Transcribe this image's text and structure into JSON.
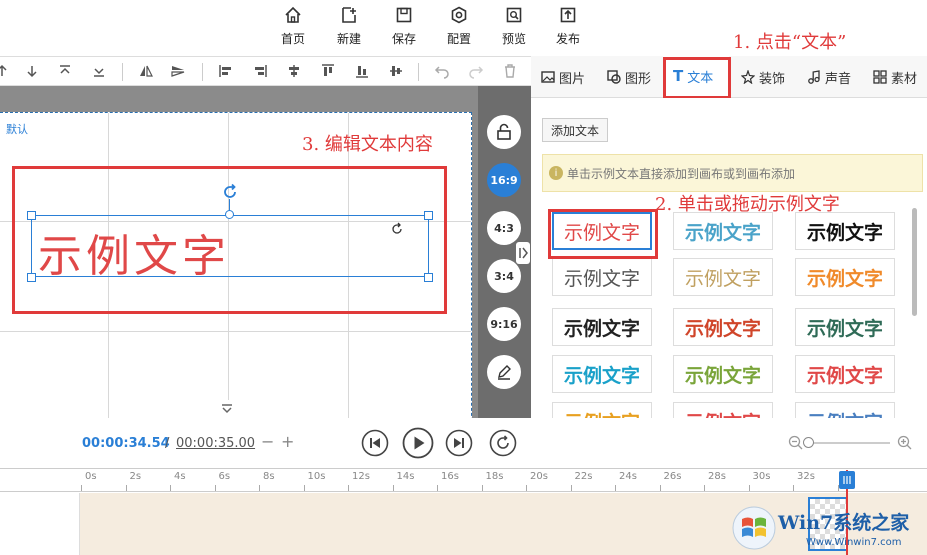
{
  "top_toolbar": {
    "home": "首页",
    "new": "新建",
    "save": "保存",
    "config": "配置",
    "preview": "预览",
    "publish": "发布"
  },
  "tabs": {
    "image": "图片",
    "shape": "图形",
    "text": "文本",
    "decoration": "装饰",
    "sound": "声音",
    "material": "素材"
  },
  "panel": {
    "add_text_button": "添加文本",
    "hint": "单击示例文本直接添加到画布或到画布添加"
  },
  "samples": [
    "示例文字",
    "示例文字",
    "示例文字",
    "示例文字",
    "示例文字",
    "示例文字",
    "示例文字",
    "示例文字",
    "示例文字",
    "示例文字",
    "示例文字",
    "示例文字",
    "示例文字",
    "示例文字",
    "示例文字"
  ],
  "sample_colors": [
    "#e04848",
    "#4aa3c9",
    "#111111",
    "#555555",
    "#c0a060",
    "#f08a2a",
    "#222222",
    "#d0452a",
    "#2f6b57",
    "#1aa1c9",
    "#7aa53a",
    "#e04848",
    "#e8a020",
    "#e04848",
    "#4a7fc0"
  ],
  "canvas": {
    "default_label": "默认",
    "text": "示例文字"
  },
  "ratios": [
    "16:9",
    "4:3",
    "3:4",
    "9:16"
  ],
  "annotations": {
    "step1": "1. 点击“文本”",
    "step2": "2. 单击或拖动示例文字",
    "step3": "3. 编辑文本内容"
  },
  "timeline": {
    "current": "00:00:34.54",
    "separator": "/",
    "total": "00:00:35.00",
    "minus": "−",
    "plus": "+",
    "ticks": [
      "0s",
      "2s",
      "4s",
      "6s",
      "8s",
      "10s",
      "12s",
      "14s",
      "16s",
      "18s",
      "20s",
      "22s",
      "24s",
      "26s",
      "28s",
      "30s",
      "32s",
      "34"
    ]
  },
  "watermark": {
    "brand": "Win7系统之家",
    "url": "Www.Winwin7.com"
  },
  "colors": {
    "accent": "#2a7fd6",
    "annotation": "#e03a3a"
  }
}
